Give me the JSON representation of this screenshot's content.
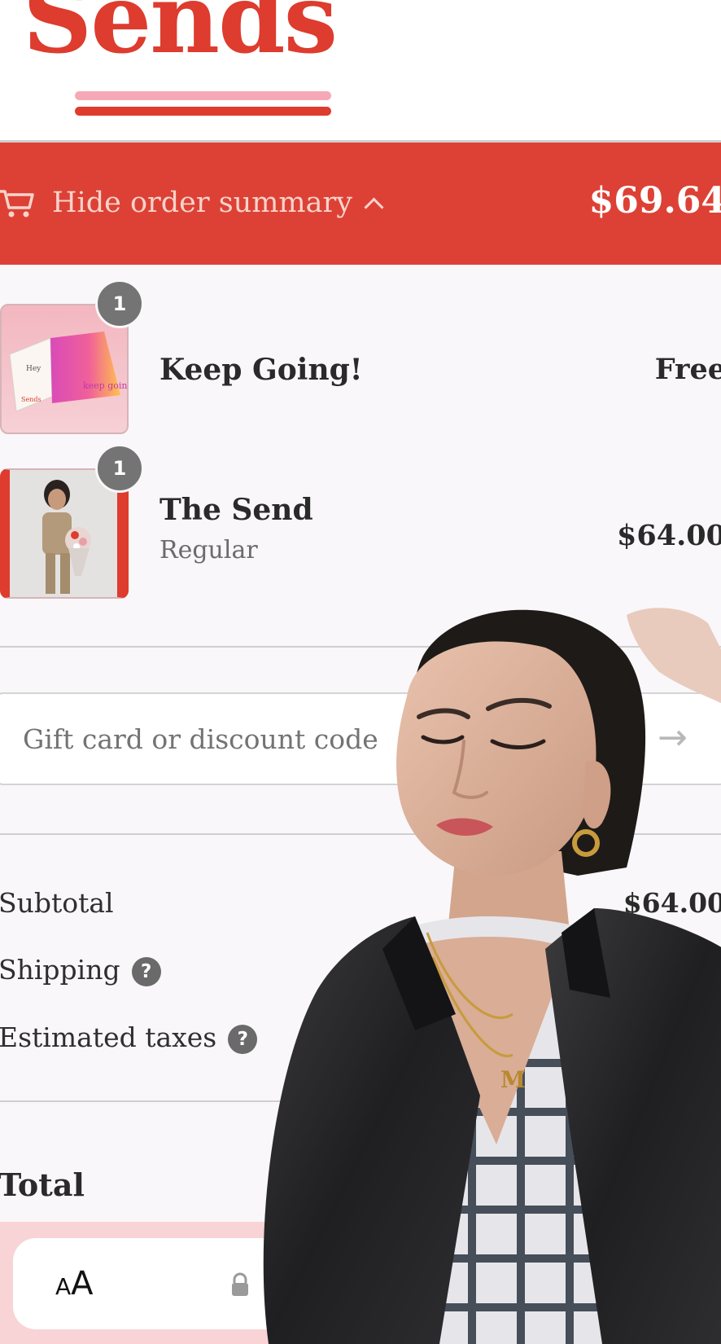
{
  "header": {
    "logo_text": "Sends",
    "back_icon": "chevron-left-icon"
  },
  "summary": {
    "toggle_label": "Hide order summary",
    "total": "$69.64",
    "cart_icon": "cart-icon"
  },
  "items": [
    {
      "quantity": "1",
      "name": "Keep Going!",
      "variant": "",
      "price": "Free"
    },
    {
      "quantity": "1",
      "name": "The Send",
      "variant": "Regular",
      "price": "$64.00"
    }
  ],
  "discount": {
    "placeholder": "Gift card or discount code"
  },
  "totals": {
    "subtotal_label": "Subtotal",
    "subtotal_value": "$64.00",
    "shipping_label": "Shipping",
    "taxes_label": "Estimated taxes",
    "total_label": "Total",
    "help_glyph": "?"
  },
  "browser": {
    "text_size_small": "A",
    "text_size_large": "A"
  },
  "colors": {
    "brand_red": "#dd4135",
    "brand_pink": "#f5a9b6",
    "page_background": "#f9f7f9"
  }
}
